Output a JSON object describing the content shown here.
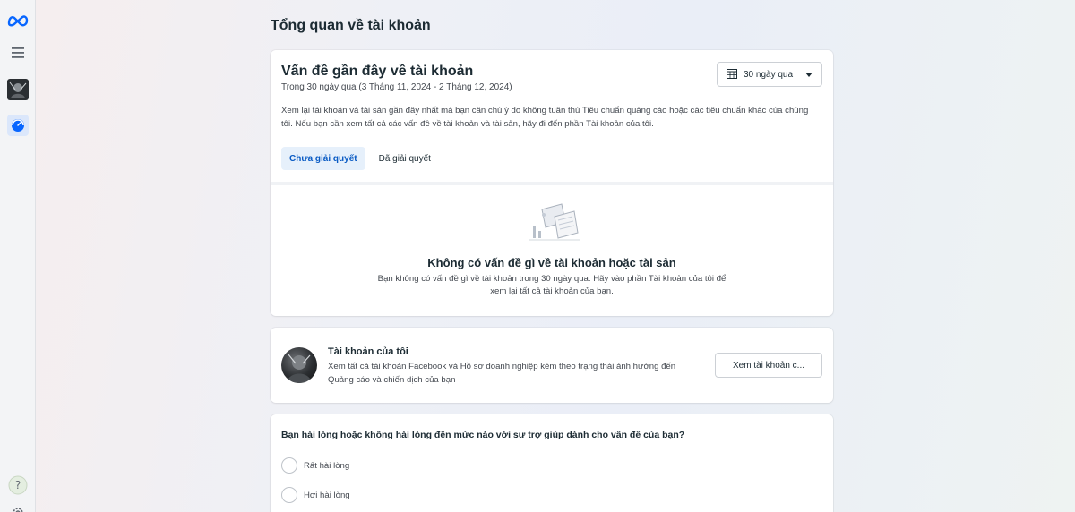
{
  "page": {
    "title": "Tổng quan về tài khoản"
  },
  "sidebar": {
    "icons": [
      "meta-logo-icon",
      "menu-icon",
      "profile-avatar",
      "dashboard-icon",
      "help-icon",
      "settings-icon"
    ],
    "help_glyph": "?"
  },
  "issues": {
    "title": "Vấn đề gần đây về tài khoản",
    "subtitle": "Trong 30 ngày qua (3 Tháng 11, 2024 - 2 Tháng 12, 2024)",
    "date_filter": "30 ngày qua",
    "description": "Xem lại tài khoản và tài sản gần đây nhất mà bạn cần chú ý do không tuân thủ Tiêu chuẩn quảng cáo hoặc các tiêu chuẩn khác của chúng tôi. Nếu bạn cần xem tất cả các vấn đề về tài khoản và tài sản, hãy đi đến phần Tài khoản của tôi.",
    "tabs": [
      {
        "label": "Chưa giải quyết",
        "active": true
      },
      {
        "label": "Đã giải quyết",
        "active": false
      }
    ],
    "empty": {
      "title": "Không có vấn đề gì về tài khoản hoặc tài sản",
      "text": "Bạn không có vấn đề gì về tài khoản trong 30 ngày qua. Hãy vào phần Tài khoản của tôi để xem lại tất cả tài khoản của bạn."
    }
  },
  "account": {
    "title": "Tài khoản của tôi",
    "description": "Xem tất cả tài khoản Facebook và Hồ sơ doanh nghiệp kèm theo trạng thái ảnh hưởng đến Quảng cáo và chiến dịch của bạn",
    "button": "Xem tài khoản c..."
  },
  "survey": {
    "question": "Bạn hài lòng hoặc không hài lòng đến mức nào với sự trợ giúp dành cho vấn đề của bạn?",
    "options": [
      "Rất hài lòng",
      "Hơi hài lòng"
    ]
  },
  "colors": {
    "accent": "#0a5bc4",
    "tab_active_bg": "#e6f0fb",
    "meta_blue": "#0866ff"
  }
}
